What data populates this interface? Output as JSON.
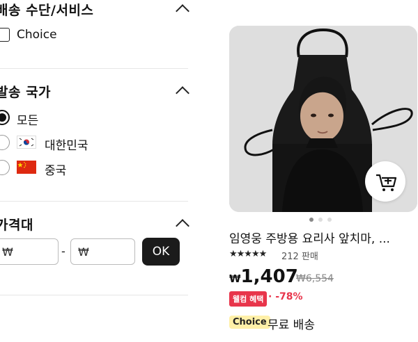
{
  "filters": {
    "shipping_service": {
      "title": "배송 수단/서비스",
      "option_label": "Choice"
    },
    "ship_from": {
      "title": "발송 국가",
      "options": [
        {
          "label": "모든",
          "selected": true
        },
        {
          "label": "대한민국",
          "flag": "south-korea"
        },
        {
          "label": "중국",
          "flag": "china"
        }
      ]
    },
    "price_range": {
      "title": "가격대",
      "min_placeholder": "₩",
      "max_placeholder": "₩",
      "separator": "-",
      "ok_label": "OK"
    }
  },
  "product": {
    "title": "임영웅 주방용 요리사 앞치마, ...",
    "rating_stars": "★★★★★",
    "sold": "212 판매",
    "currency": "₩",
    "price": "1,407",
    "original_price": "₩6,554",
    "deal_badge": "웰컴 혜택",
    "discount": "· -78%",
    "choice_badge": "Choice",
    "shipping": "무료 배송"
  },
  "colors": {
    "accent_red": "#e8354b",
    "dark": "#1b1b1b",
    "choice_yellow": "#fff0a8"
  }
}
